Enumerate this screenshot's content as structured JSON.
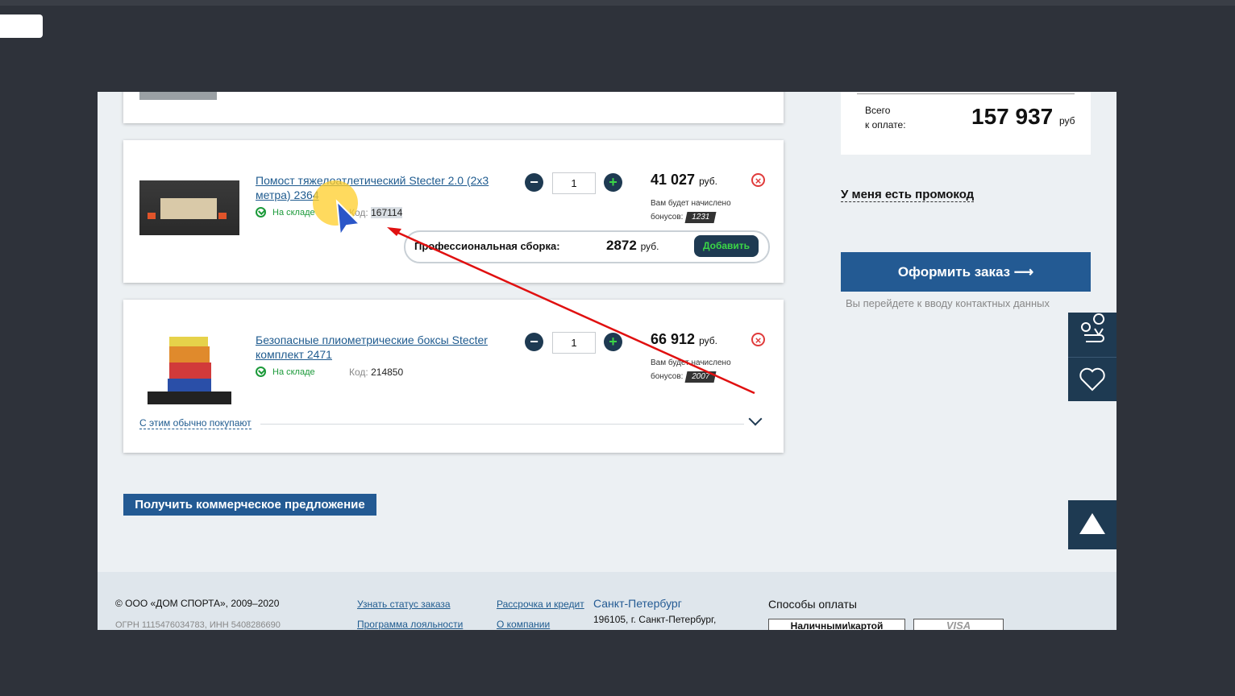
{
  "cart": {
    "items": [
      {
        "title": "Помост тяжелоатлетический Stecter 2.0 (2х3 метра) 2364",
        "stock": "На складе",
        "code_label": "Код:",
        "code": "167114",
        "qty": "1",
        "price": "41 027",
        "currency": "руб.",
        "bonus_line1": "Вам будет начислено",
        "bonus_line2": "бонусов:",
        "bonus": "1231",
        "assembly_label": "Профессиональная сборка:",
        "assembly_price": "2872",
        "assembly_currency": "руб.",
        "assembly_button": "Добавить"
      },
      {
        "title": "Безопасные плиометрические боксы Stecter комплект 2471",
        "stock": "На складе",
        "code_label": "Код:",
        "code": "214850",
        "qty": "1",
        "price": "66 912",
        "currency": "руб.",
        "bonus_line1": "Вам будет начислено",
        "bonus_line2": "бонусов:",
        "bonus": "2007"
      }
    ],
    "also_bought": "С этим обычно покупают",
    "commercial_offer": "Получить коммерческое предложение"
  },
  "summary": {
    "total_label_1": "Всего",
    "total_label_2": "к оплате:",
    "total": "157 937",
    "total_currency": "руб",
    "promo": "У меня есть промокод",
    "order_button": "Оформить заказ ⟶",
    "order_hint": "Вы перейдете к вводу контактных данных"
  },
  "footer": {
    "copyright": "© ООО «ДОМ СПОРТА», 2009–2020",
    "ogrn": "ОГРН 1115476034783, ИНН 5408286690",
    "links_col1": [
      "Узнать статус заказа",
      "Программа лояльности"
    ],
    "links_col2": [
      "Рассрочка и кредит",
      "О компании"
    ],
    "city": "Санкт-Петербург",
    "address": "196105, г. Санкт-Петербург,",
    "payment_title": "Способы оплаты",
    "payment_cash": "Наличными\\картой",
    "payment_visa": "VISA"
  },
  "colors": {
    "accent": "#235a93",
    "dark": "#1e3a52",
    "stock_green": "#1c9a3a",
    "remove_red": "#e03b3b"
  }
}
